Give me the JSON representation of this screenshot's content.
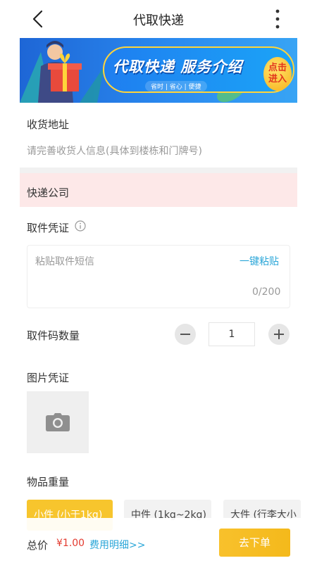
{
  "nav": {
    "title": "代取快递",
    "back_icon": "chevron-left-icon",
    "more_icon": "more-vertical-icon"
  },
  "banner": {
    "title": "代取快递 服务介绍",
    "subtitle": "省时 | 省心 | 便捷",
    "button_label": "点击\n进入",
    "button_line1": "点击",
    "button_line2": "进入"
  },
  "address": {
    "label": "收货地址",
    "placeholder": "请完善收货人信息(具体到楼栋和门牌号)"
  },
  "courier": {
    "label": "快递公司"
  },
  "pickup_credential": {
    "label": "取件凭证",
    "placeholder": "粘贴取件短信",
    "paste_label": "一键粘贴",
    "counter": "0/200"
  },
  "code_count": {
    "label": "取件码数量",
    "value": "1"
  },
  "photo": {
    "label": "图片凭证",
    "icon": "camera-icon"
  },
  "weight": {
    "label": "物品重量",
    "options": [
      {
        "label": "小件 (小于1kg)",
        "selected": true
      },
      {
        "label": "中件 (1kg~2kg)",
        "selected": false
      },
      {
        "label": "大件 (行李大小",
        "selected": false
      }
    ]
  },
  "footer": {
    "total_label": "总价",
    "total_price": "¥1.00",
    "fee_detail": "费用明细>>",
    "submit_label": "去下单"
  },
  "colors": {
    "accent": "#f7c52d",
    "link": "#2aa6d8",
    "price": "#e33a2f",
    "highlight_row": "#fde8e8"
  }
}
